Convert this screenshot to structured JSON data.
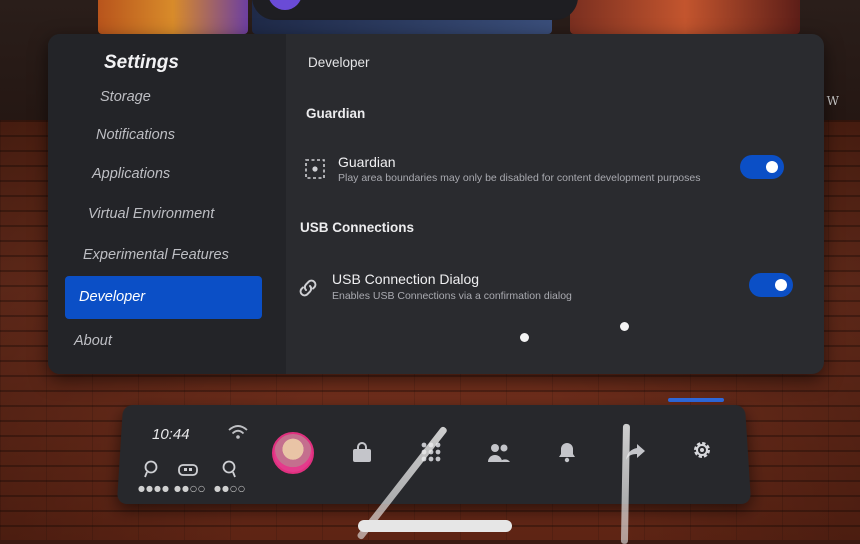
{
  "environment": {
    "side_text": "The W"
  },
  "settings": {
    "title": "Settings",
    "nav": [
      {
        "label": "Storage"
      },
      {
        "label": "Notifications"
      },
      {
        "label": "Applications"
      },
      {
        "label": "Virtual Environment"
      },
      {
        "label": "Experimental Features"
      },
      {
        "label": "Developer",
        "active": true
      },
      {
        "label": "About"
      }
    ],
    "content": {
      "title": "Developer",
      "sections": [
        {
          "heading": "Guardian",
          "row": {
            "icon": "guardian-boundary-icon",
            "title": "Guardian",
            "subtitle": "Play area boundaries may only be disabled for content development purposes",
            "toggle_on": true
          }
        },
        {
          "heading": "USB Connections",
          "row": {
            "icon": "link-icon",
            "title": "USB Connection Dialog",
            "subtitle": "Enables USB Connections via a confirmation dialog",
            "toggle_on": true
          }
        }
      ]
    },
    "accent_color": "#0b4fc6"
  },
  "dock": {
    "time": "10:44",
    "status_icons": [
      "wifi-icon",
      "left-controller-icon",
      "headset-icon",
      "right-controller-icon"
    ],
    "battery_dots": [
      "●●●●",
      "●●○○",
      "●●○○"
    ],
    "apps": [
      "avatar",
      "store-icon",
      "apps-grid-icon",
      "people-icon",
      "notifications-bell-icon",
      "share-icon",
      "settings-gear-icon"
    ]
  }
}
